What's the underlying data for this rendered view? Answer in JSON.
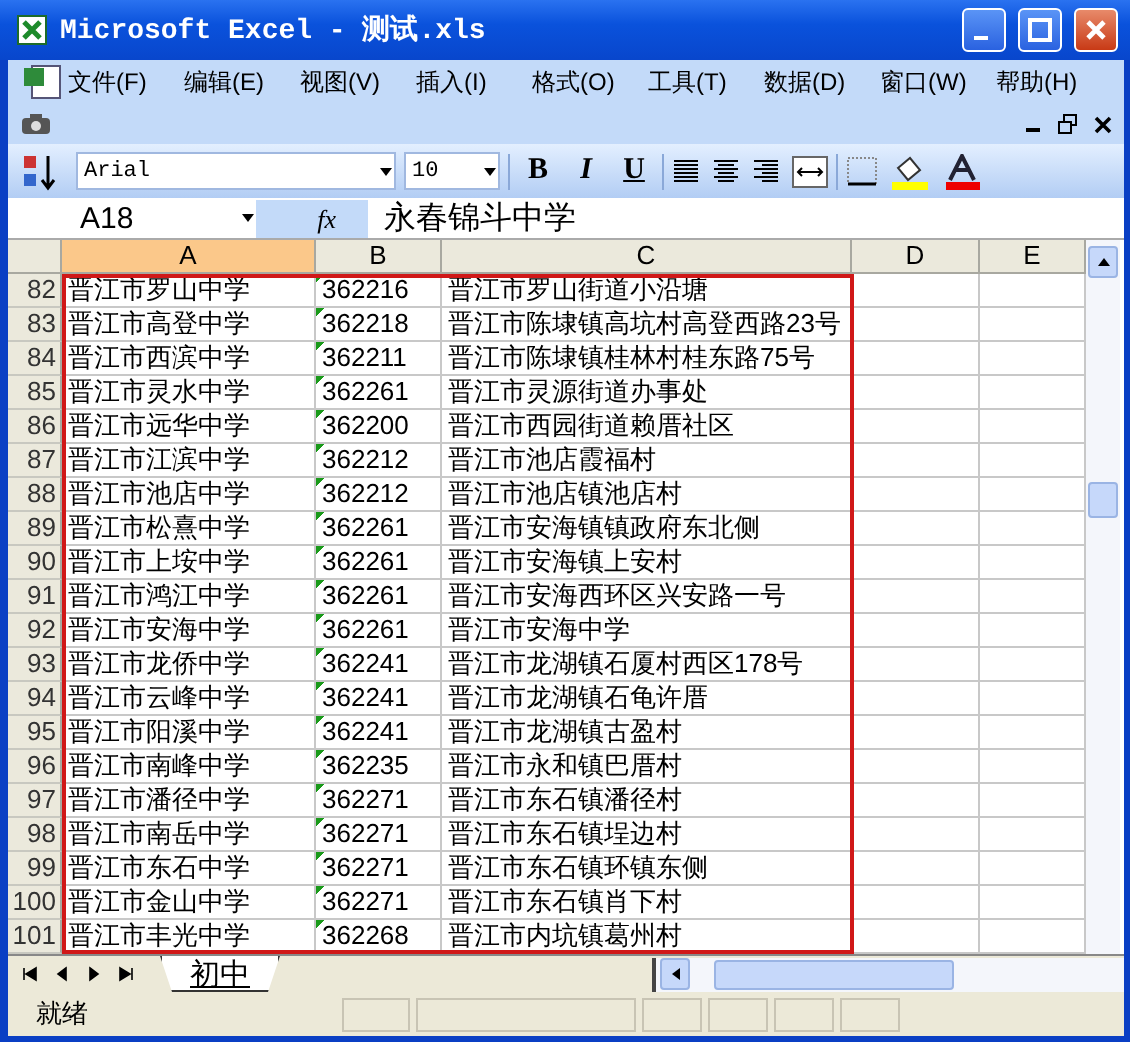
{
  "window": {
    "title": "Microsoft Excel - 测试.xls"
  },
  "menu": [
    "文件(F)",
    "编辑(E)",
    "视图(V)",
    "插入(I)",
    "格式(O)",
    "工具(T)",
    "数据(D)",
    "窗口(W)",
    "帮助(H)"
  ],
  "toolbar": {
    "font": "Arial",
    "size": "10",
    "styles": [
      "B",
      "I",
      "U"
    ]
  },
  "formula_bar": {
    "name_box": "A18",
    "fx": "fx",
    "value": "永春锦斗中学"
  },
  "columns": [
    {
      "label": "A",
      "selected": true
    },
    {
      "label": "B",
      "selected": false
    },
    {
      "label": "C",
      "selected": false
    },
    {
      "label": "D",
      "selected": false
    },
    {
      "label": "E",
      "selected": false
    }
  ],
  "rows": [
    {
      "number": "82",
      "cells": [
        "晋江市罗山中学",
        "362216",
        "晋江市罗山街道小沿塘"
      ]
    },
    {
      "number": "83",
      "cells": [
        "晋江市高登中学",
        "362218",
        "晋江市陈埭镇高坑村高登西路23号"
      ]
    },
    {
      "number": "84",
      "cells": [
        "晋江市西滨中学",
        "362211",
        "晋江市陈埭镇桂林村桂东路75号"
      ]
    },
    {
      "number": "85",
      "cells": [
        "晋江市灵水中学",
        "362261",
        "晋江市灵源街道办事处"
      ]
    },
    {
      "number": "86",
      "cells": [
        "晋江市远华中学",
        "362200",
        "晋江市西园街道赖厝社区"
      ]
    },
    {
      "number": "87",
      "cells": [
        "晋江市江滨中学",
        "362212",
        "晋江市池店霞福村"
      ]
    },
    {
      "number": "88",
      "cells": [
        "晋江市池店中学",
        "362212",
        "晋江市池店镇池店村"
      ]
    },
    {
      "number": "89",
      "cells": [
        "晋江市松熹中学",
        "362261",
        "晋江市安海镇镇政府东北侧"
      ]
    },
    {
      "number": "90",
      "cells": [
        "晋江市上垵中学",
        "362261",
        "晋江市安海镇上安村"
      ]
    },
    {
      "number": "91",
      "cells": [
        "晋江市鸿江中学",
        "362261",
        "晋江市安海西环区兴安路一号"
      ]
    },
    {
      "number": "92",
      "cells": [
        "晋江市安海中学",
        "362261",
        "晋江市安海中学"
      ]
    },
    {
      "number": "93",
      "cells": [
        "晋江市龙侨中学",
        "362241",
        "晋江市龙湖镇石厦村西区178号"
      ]
    },
    {
      "number": "94",
      "cells": [
        "晋江市云峰中学",
        "362241",
        "晋江市龙湖镇石龟许厝"
      ]
    },
    {
      "number": "95",
      "cells": [
        "晋江市阳溪中学",
        "362241",
        "晋江市龙湖镇古盈村"
      ]
    },
    {
      "number": "96",
      "cells": [
        "晋江市南峰中学",
        "362235",
        "晋江市永和镇巴厝村"
      ]
    },
    {
      "number": "97",
      "cells": [
        "晋江市潘径中学",
        "362271",
        "晋江市东石镇潘径村"
      ]
    },
    {
      "number": "98",
      "cells": [
        "晋江市南岳中学",
        "362271",
        "晋江市东石镇埕边村"
      ]
    },
    {
      "number": "99",
      "cells": [
        "晋江市东石中学",
        "362271",
        "晋江市东石镇环镇东侧"
      ]
    },
    {
      "number": "100",
      "cells": [
        "晋江市金山中学",
        "362271",
        "晋江市东石镇肖下村"
      ]
    },
    {
      "number": "101",
      "cells": [
        "晋江市丰光中学",
        "362268",
        "晋江市内坑镇葛州村"
      ]
    }
  ],
  "sheet_tabs": [
    {
      "label": "初中",
      "selected": true
    }
  ],
  "status_bar": {
    "text": "就绪"
  }
}
